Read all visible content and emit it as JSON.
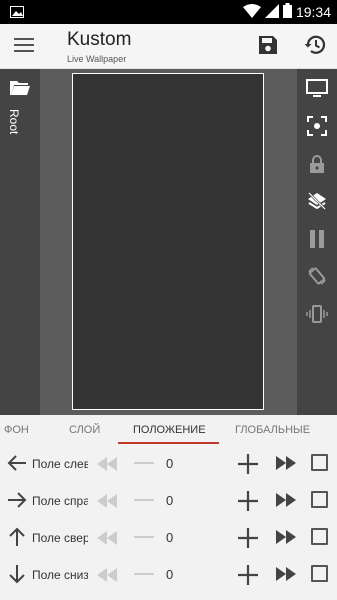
{
  "statusbar": {
    "time": "19:34",
    "icons": [
      "image-icon",
      "wifi-icon",
      "signal-icon",
      "battery-icon"
    ]
  },
  "appbar": {
    "title": "Kustom",
    "subtitle": "Live Wallpaper",
    "icons": [
      "menu-icon",
      "save-icon",
      "history-icon"
    ]
  },
  "editor": {
    "left_panel_label": "Root",
    "right_tools": [
      "preview-icon",
      "focus-icon",
      "lock-icon",
      "layers-icon",
      "pause-icon",
      "rotate-icon",
      "vibrate-icon"
    ]
  },
  "tabs": [
    {
      "label": "ФОН",
      "active": false
    },
    {
      "label": "СЛОЙ",
      "active": false
    },
    {
      "label": "ПОЛОЖЕНИЕ",
      "active": true
    },
    {
      "label": "ГЛОБАЛЬНЫЕ",
      "active": false
    }
  ],
  "rows": [
    {
      "arrow": "arrow-left-icon",
      "label": "Поле слева",
      "value": "0"
    },
    {
      "arrow": "arrow-right-icon",
      "label": "Поле справа",
      "value": "0"
    },
    {
      "arrow": "arrow-up-icon",
      "label": "Поле сверху",
      "value": "0"
    },
    {
      "arrow": "arrow-down-icon",
      "label": "Поле снизу",
      "value": "0"
    }
  ],
  "colors": {
    "accent": "#c0392b",
    "editor_bg": "#5d5d5d",
    "panel_bg": "#444444",
    "canvas_bg": "#333333"
  }
}
